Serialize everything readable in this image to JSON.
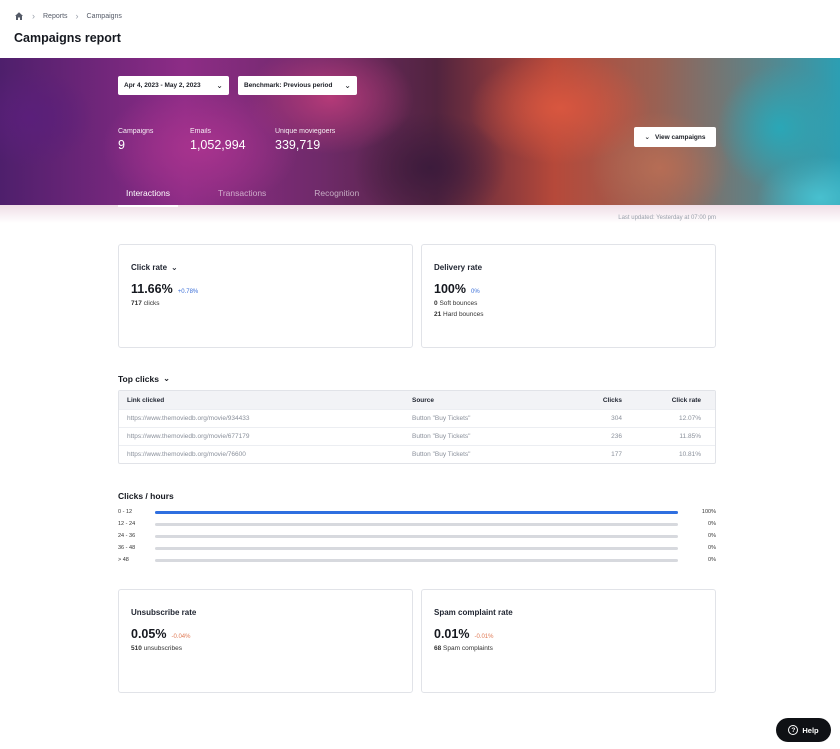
{
  "breadcrumb": {
    "items": [
      "Reports",
      "Campaigns"
    ]
  },
  "page": {
    "title": "Campaigns report"
  },
  "filters": {
    "date_range": "Apr 4, 2023 - May 2, 2023",
    "benchmark": "Benchmark: Previous period"
  },
  "stats": [
    {
      "label": "Campaigns",
      "value": "9"
    },
    {
      "label": "Emails",
      "value": "1,052,994"
    },
    {
      "label": "Unique moviegoers",
      "value": "339,719"
    }
  ],
  "view_campaigns_label": "View campaigns",
  "tabs": [
    {
      "label": "Interactions",
      "active": true
    },
    {
      "label": "Transactions",
      "active": false
    },
    {
      "label": "Recognition",
      "active": false
    }
  ],
  "last_updated": "Last updated: Yesterday at 07:00 pm",
  "click_rate": {
    "title": "Click rate",
    "value": "11.66%",
    "delta": "+0.78%",
    "count": "717",
    "count_label": "clicks"
  },
  "delivery_rate": {
    "title": "Delivery rate",
    "value": "100%",
    "delta": "0%",
    "soft": "0",
    "soft_label": "Soft bounces",
    "hard": "21",
    "hard_label": "Hard bounces"
  },
  "top_clicks": {
    "title": "Top clicks",
    "columns": [
      "Link clicked",
      "Source",
      "Clicks",
      "Click rate"
    ],
    "rows": [
      [
        "https://www.themoviedb.org/movie/934433",
        "Button \"Buy Tickets\"",
        "304",
        "12.07%"
      ],
      [
        "https://www.themoviedb.org/movie/677179",
        "Button \"Buy Tickets\"",
        "236",
        "11.85%"
      ],
      [
        "https://www.themoviedb.org/movie/76600",
        "Button \"Buy Tickets\"",
        "177",
        "10.81%"
      ]
    ]
  },
  "clicks_hours": {
    "title": "Clicks / hours",
    "rows": [
      {
        "label": "0 - 12",
        "pct": "100%",
        "fraction": 1.0
      },
      {
        "label": "12 - 24",
        "pct": "0%",
        "fraction": 0
      },
      {
        "label": "24 - 36",
        "pct": "0%",
        "fraction": 0
      },
      {
        "label": "36 - 48",
        "pct": "0%",
        "fraction": 0
      },
      {
        "label": "> 48",
        "pct": "0%",
        "fraction": 0
      }
    ],
    "fill_color": "#2f6fe0"
  },
  "unsubscribe_rate": {
    "title": "Unsubscribe rate",
    "value": "0.05%",
    "delta": "-0.04%",
    "count": "510",
    "count_label": "unsubscribes"
  },
  "spam_rate": {
    "title": "Spam complaint rate",
    "value": "0.01%",
    "delta": "-0.01%",
    "count": "68",
    "count_label": "Spam complaints"
  },
  "help": {
    "label": "Help"
  },
  "colors": {
    "positive": "#3b6fd8",
    "negative": "#e07a55",
    "accent": "#2f6fe0"
  }
}
